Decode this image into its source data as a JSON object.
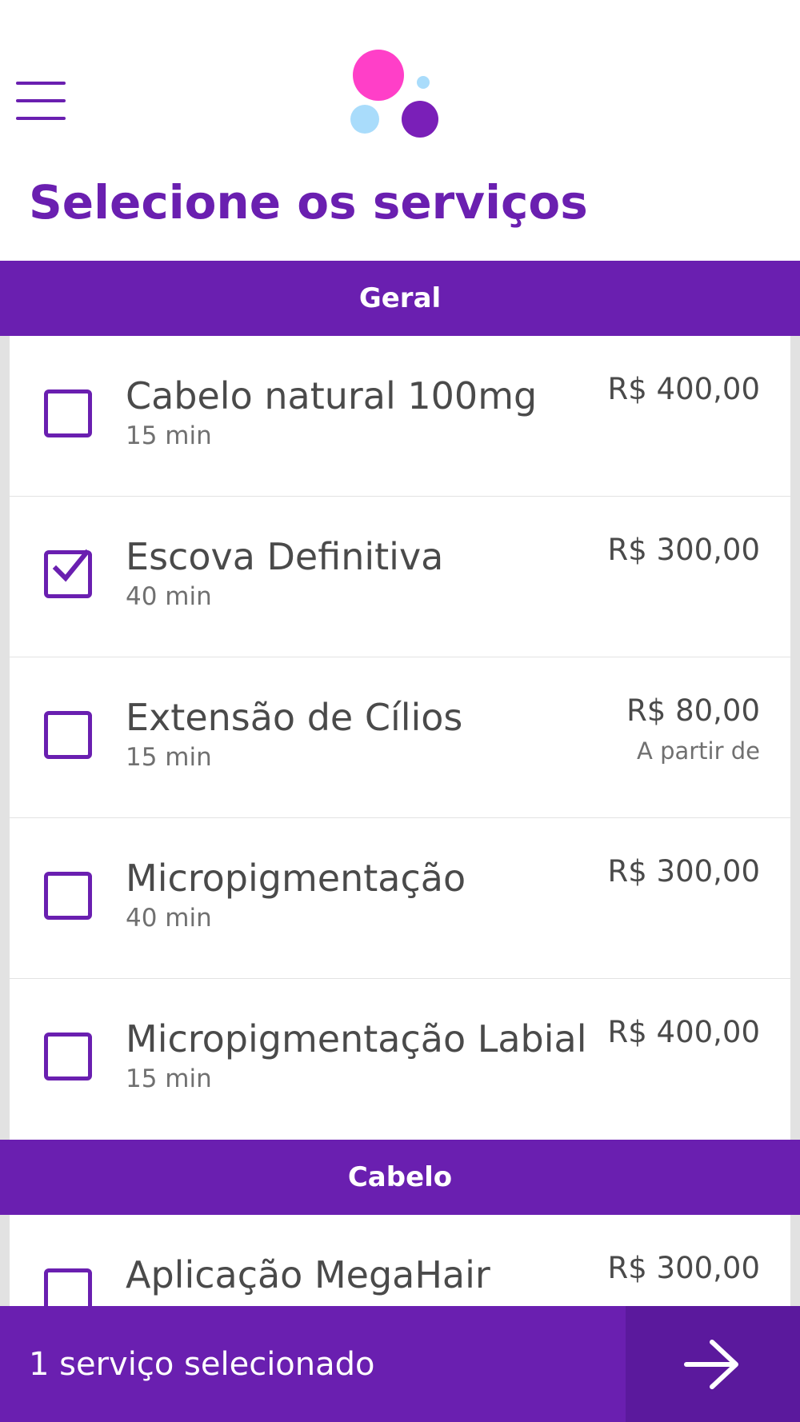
{
  "header": {
    "menu_icon": "hamburger-menu-icon",
    "logo_icon": "bubbles-logo-icon",
    "logo_colors": {
      "pink": "#ff3fc8",
      "light_blue": "#a9dcfb",
      "purple": "#7a1fb8"
    },
    "title": "Selecione os serviços"
  },
  "theme": {
    "accent": "#6a1fb0",
    "accent_dark": "#5b199d",
    "text": "#4a4a4a",
    "muted": "#707070"
  },
  "sections": [
    {
      "title": "Geral",
      "services": [
        {
          "name": "Cabelo natural 100mg",
          "duration": "15 min",
          "price": "R$ 400,00",
          "note": "",
          "checked": false
        },
        {
          "name": "Escova Definitiva",
          "duration": "40 min",
          "price": "R$ 300,00",
          "note": "",
          "checked": true
        },
        {
          "name": "Extensão de Cílios",
          "duration": "15 min",
          "price": "R$ 80,00",
          "note": "A partir de",
          "checked": false
        },
        {
          "name": "Micropigmentação",
          "duration": "40 min",
          "price": "R$ 300,00",
          "note": "",
          "checked": false
        },
        {
          "name": "Micropigmentação Labial",
          "duration": "15 min",
          "price": "R$ 400,00",
          "note": "",
          "checked": false
        }
      ]
    },
    {
      "title": "Cabelo",
      "services": [
        {
          "name": "Aplicação MegaHair",
          "duration": "",
          "price": "R$ 300,00",
          "note": "",
          "checked": false
        }
      ]
    }
  ],
  "footer": {
    "selection_text": "1 serviço selecionado",
    "next_icon": "arrow-right-icon"
  }
}
